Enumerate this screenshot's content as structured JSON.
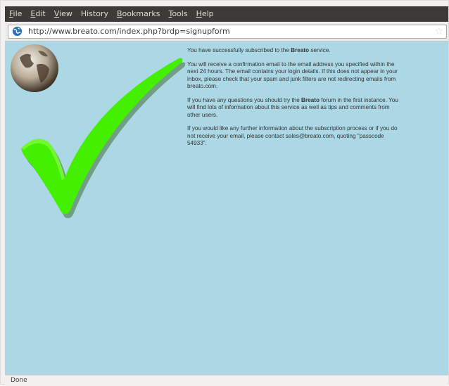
{
  "menu": {
    "items": [
      {
        "key": "F",
        "rest": "ile"
      },
      {
        "key": "E",
        "rest": "dit"
      },
      {
        "key": "V",
        "rest": "iew"
      },
      {
        "key": "",
        "rest": "History"
      },
      {
        "key": "B",
        "rest": "ookmarks"
      },
      {
        "key": "T",
        "rest": "ools"
      },
      {
        "key": "H",
        "rest": "elp"
      }
    ]
  },
  "nav": {
    "url": "http://www.breato.com/index.php?brdp=signupform"
  },
  "page": {
    "p1_before": "You have successfully subscribed to the ",
    "p1_brand": "Breato",
    "p1_after": " service.",
    "p2": "You will receive a confirmation email to the email address you specified within the next 24 hours.  The email contains your login details.  If this does not appear in your inbox, please check that your spam and junk filters are not redirecting emails from breato.com.",
    "p3_before": "If you have any questions you should try the ",
    "p3_brand": "Breato",
    "p3_after": " forum in the first instance.  You will find lots of information about this service as well as tips and comments from other users.",
    "p4": "If you would like any further information about the subscription process or if you do not receive your email, please contact sales@breato.com, quoting \"passcode 54933\"."
  },
  "status": {
    "text": "Done"
  },
  "icons": {
    "site": "globe-favicon-icon",
    "star": "bookmark-star-icon",
    "logo": "earth-globe-icon",
    "check": "green-checkmark-icon"
  },
  "colors": {
    "content_bg": "#acd8e5",
    "menubar_bg": "#3c3b37",
    "check_green": "#44f000"
  }
}
